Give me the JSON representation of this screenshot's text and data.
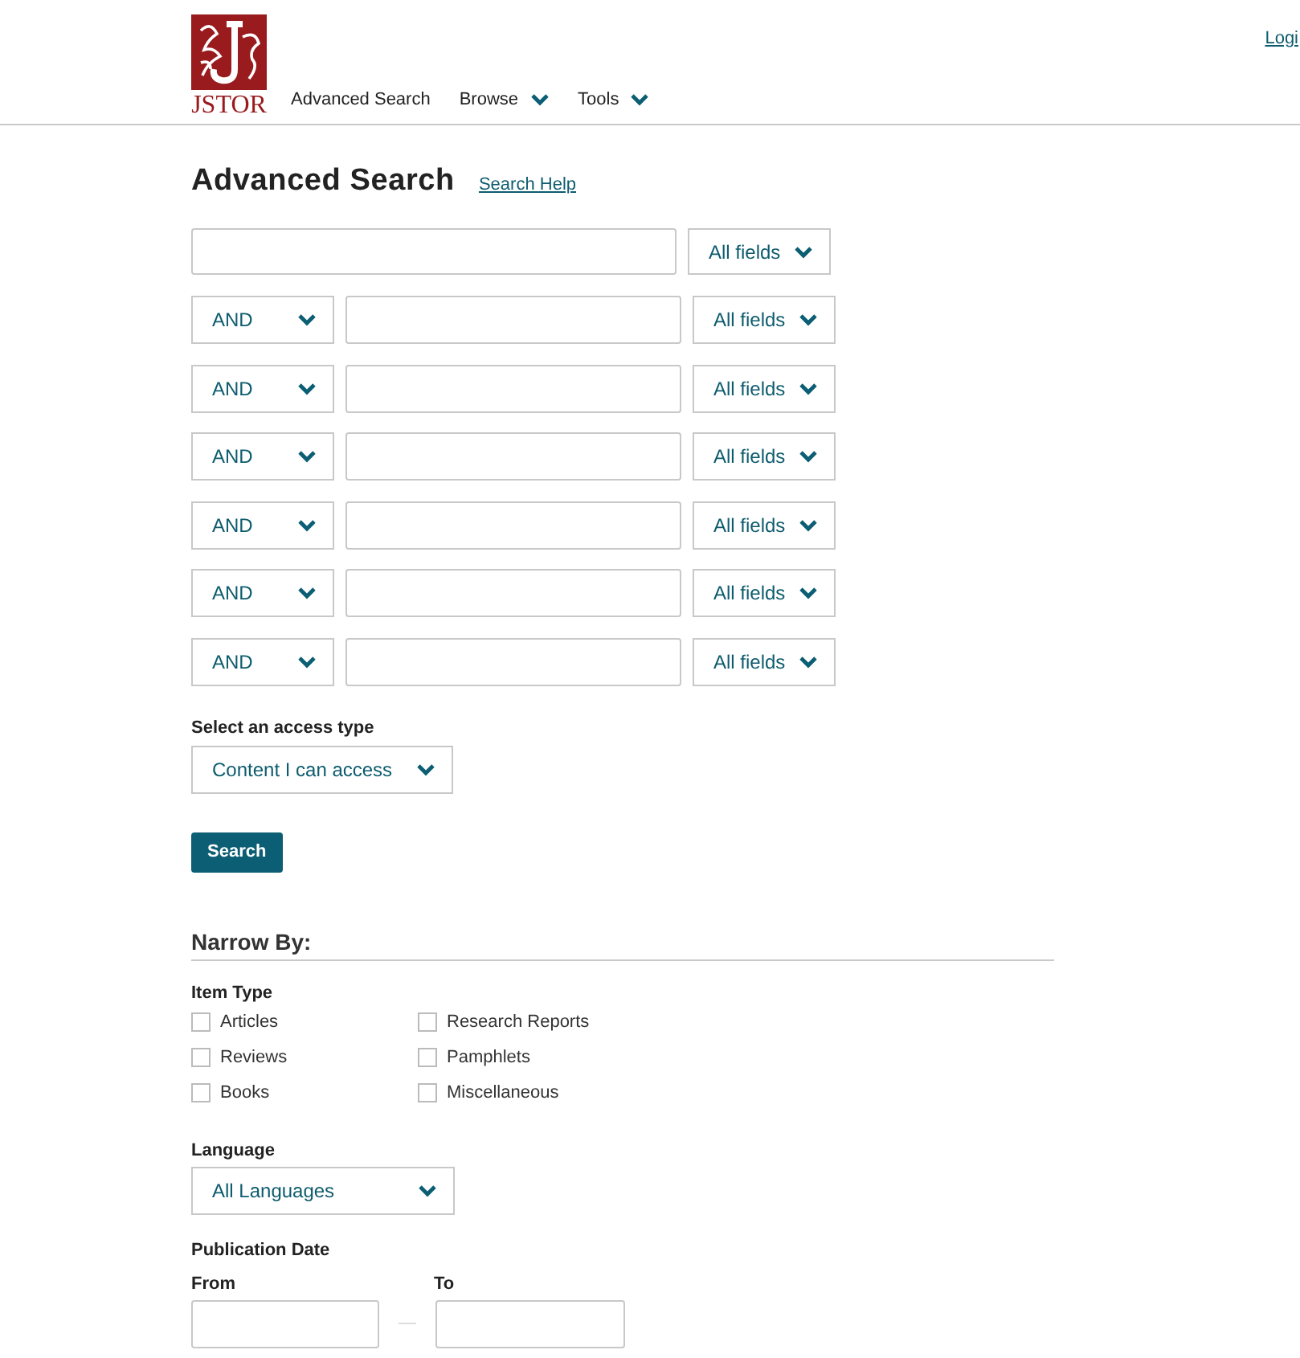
{
  "header": {
    "logo_text": "JSTOR",
    "nav": [
      {
        "label": "Advanced Search",
        "dropdown": false
      },
      {
        "label": "Browse",
        "dropdown": true
      },
      {
        "label": "Tools",
        "dropdown": true
      }
    ],
    "login": "Logi"
  },
  "title": "Advanced Search",
  "help_link": "Search Help",
  "first_row": {
    "field": "All fields"
  },
  "rows": [
    {
      "operator": "AND",
      "field": "All fields"
    },
    {
      "operator": "AND",
      "field": "All fields"
    },
    {
      "operator": "AND",
      "field": "All fields"
    },
    {
      "operator": "AND",
      "field": "All fields"
    },
    {
      "operator": "AND",
      "field": "All fields"
    },
    {
      "operator": "AND",
      "field": "All fields"
    }
  ],
  "access": {
    "label": "Select an access type",
    "value": "Content I can access"
  },
  "search_button": "Search",
  "narrow": {
    "title": "Narrow By:",
    "item_type_label": "Item Type",
    "item_types": [
      {
        "label": "Articles",
        "checked": false
      },
      {
        "label": "Research Reports",
        "checked": false
      },
      {
        "label": "Reviews",
        "checked": false
      },
      {
        "label": "Pamphlets",
        "checked": false
      },
      {
        "label": "Books",
        "checked": false
      },
      {
        "label": "Miscellaneous",
        "checked": false
      }
    ],
    "language_label": "Language",
    "language": "All Languages",
    "date_label": "Publication Date",
    "from_label": "From",
    "to_label": "To"
  }
}
